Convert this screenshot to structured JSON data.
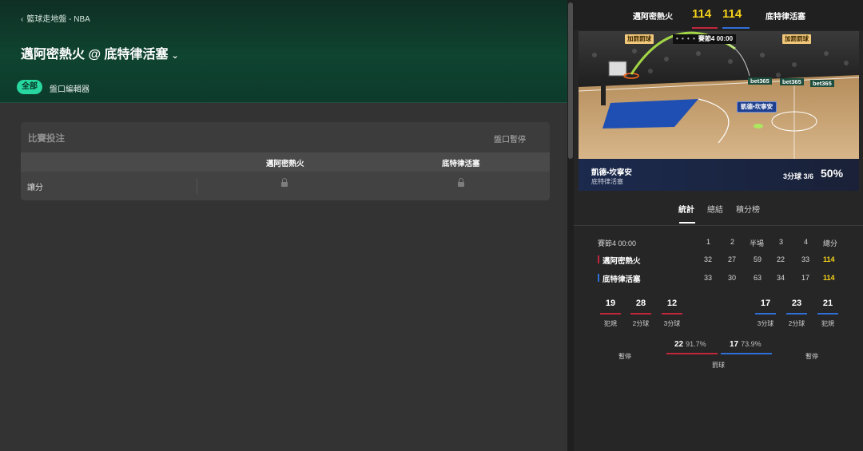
{
  "header": {
    "breadcrumb": "籃球走地盤 - NBA",
    "title": "邁阿密熱火 @ 底特律活塞",
    "tabs": [
      {
        "label": "全部",
        "active": true
      },
      {
        "label": "盤口編輯器",
        "active": false
      }
    ]
  },
  "market": {
    "title": "比賽投注",
    "status": "盤口暫停",
    "columns": [
      "邁阿密熱火",
      "底特律活塞"
    ],
    "rows": [
      {
        "label": "讓分"
      }
    ]
  },
  "scoreboard": {
    "home": "邁阿密熱火",
    "home_score": "114",
    "away": "底特律活塞",
    "away_score": "114"
  },
  "court": {
    "left_tag": "加罰罰球",
    "right_tag": "加罰罰球",
    "period_label": "賽節4",
    "clock": "00:00",
    "player_badge": "凱德•坎寧安",
    "footer_player": "凱德•坎寧安",
    "footer_team": "底特律活塞",
    "footer_stat": "3分球 3/6",
    "footer_pct": "50%",
    "ads": [
      "bet365",
      "bet365",
      "bet365"
    ]
  },
  "stats_tabs": [
    {
      "label": "統計",
      "active": true
    },
    {
      "label": "總結"
    },
    {
      "label": "積分榜"
    }
  ],
  "box": {
    "period_header": "賽節4 00:00",
    "headers": [
      "1",
      "2",
      "半場",
      "3",
      "4",
      "總分"
    ],
    "teams": [
      {
        "name": "邁阿密熱火",
        "values": [
          "32",
          "27",
          "59",
          "22",
          "33",
          "114"
        ],
        "color": "#c2263c"
      },
      {
        "name": "底特律活塞",
        "values": [
          "33",
          "30",
          "63",
          "34",
          "17",
          "114"
        ],
        "color": "#2f6fd8"
      }
    ]
  },
  "team_stats": {
    "home": [
      {
        "value": "19",
        "label": "犯規"
      },
      {
        "value": "28",
        "label": "2分球"
      },
      {
        "value": "12",
        "label": "3分球"
      }
    ],
    "away": [
      {
        "value": "17",
        "label": "3分球"
      },
      {
        "value": "23",
        "label": "2分球"
      },
      {
        "value": "21",
        "label": "犯規"
      }
    ],
    "timeout_label": "暫停",
    "free_throws": {
      "label": "罰球",
      "home_value": "22",
      "home_pct": "91.7%",
      "away_value": "17",
      "away_pct": "73.9%"
    }
  }
}
